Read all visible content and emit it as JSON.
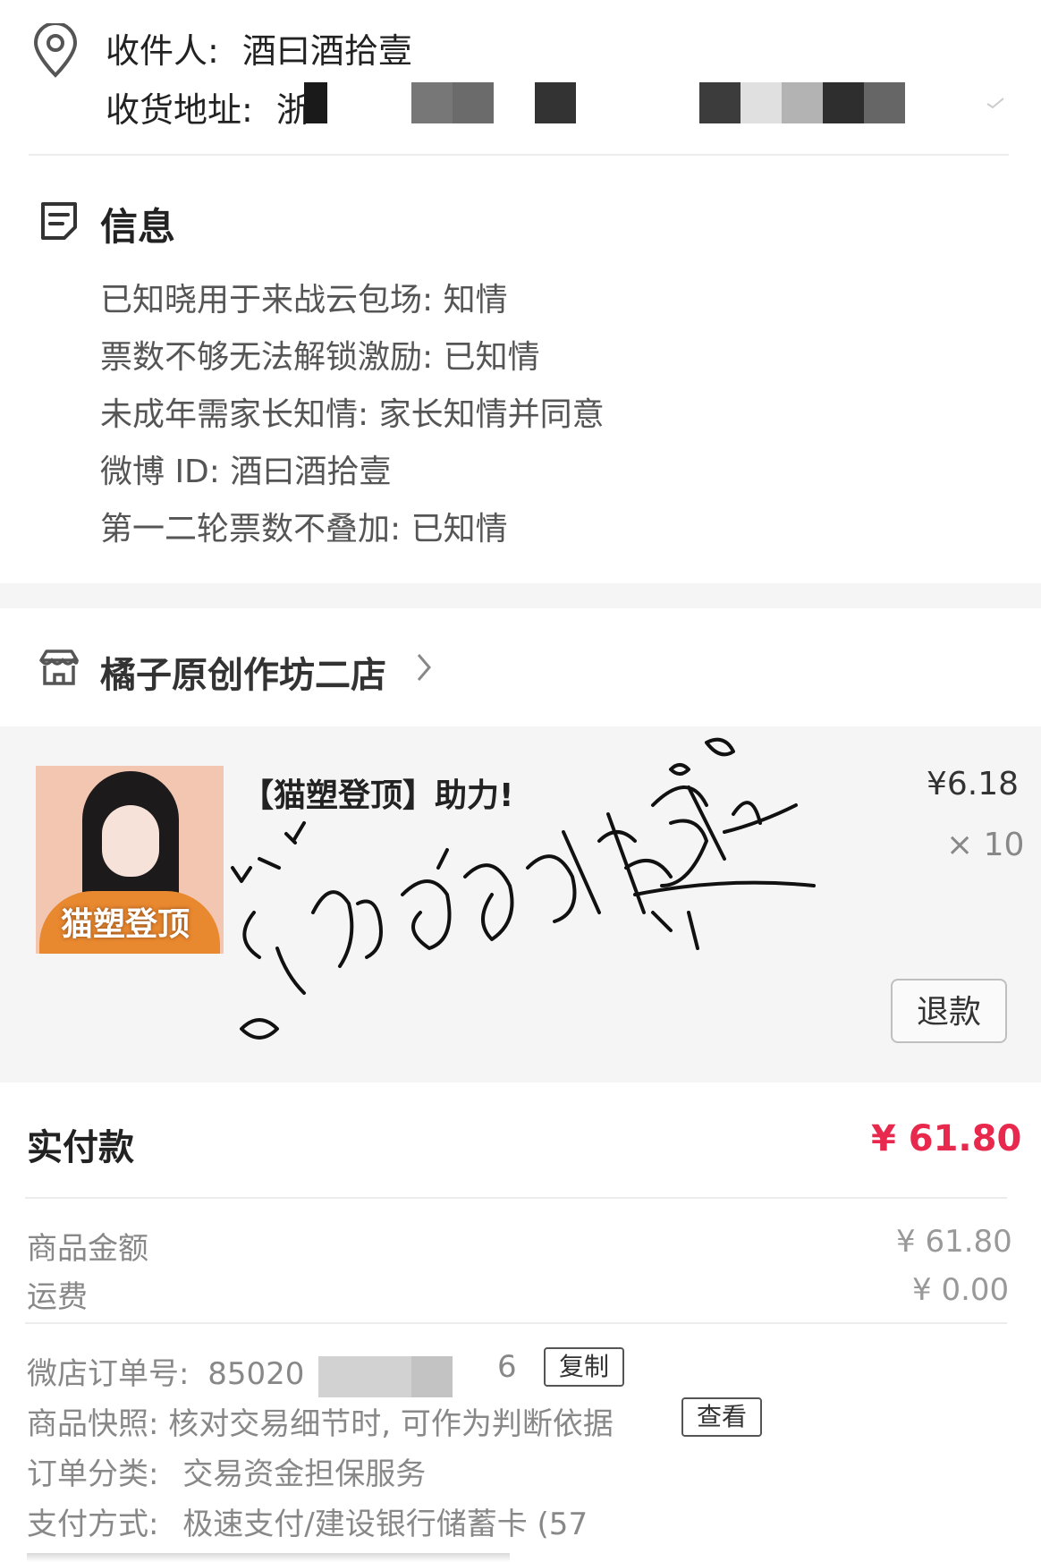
{
  "address": {
    "recipient_label": "收件人:",
    "recipient_name": "酒曰酒拾壹",
    "address_label": "收货地址:",
    "address_visible_char": "浙"
  },
  "info": {
    "title": "信息",
    "lines": [
      "已知晓用于来战云包场: 知情",
      "票数不够无法解锁激励: 已知情",
      "未成年需家长知情: 家长知情并同意",
      "微博 ID: 酒曰酒拾壹",
      "第一二轮票数不叠加: 已知情"
    ]
  },
  "store": {
    "name": "橘子原创作坊二店"
  },
  "product": {
    "title": "【猫塑登顶】助力!",
    "price": "¥6.18",
    "quantity": "× 10",
    "thumbnail_text": "猫塑登顶",
    "refund_label": "退款"
  },
  "totals": {
    "paid_label": "实付款",
    "paid_value": "¥ 61.80",
    "goods_label": "商品金额",
    "goods_value": "¥ 61.80",
    "shipping_label": "运费",
    "shipping_value": "¥ 0.00"
  },
  "order_meta": {
    "order_no_label": "微店订单号:",
    "order_no_prefix": "85020",
    "order_no_suffix": "6",
    "copy_label": "复制",
    "snapshot_text": "商品快照: 核对交易细节时, 可作为判断依据",
    "view_label": "查看",
    "category_label": "订单分类:",
    "category_value": "交易资金担保服务",
    "payment_label": "支付方式:",
    "payment_value": "极速支付/建设银行储蓄卡 (57"
  },
  "colors": {
    "accent_price": "#e8284c",
    "section_bg": "#f5f5f5"
  }
}
